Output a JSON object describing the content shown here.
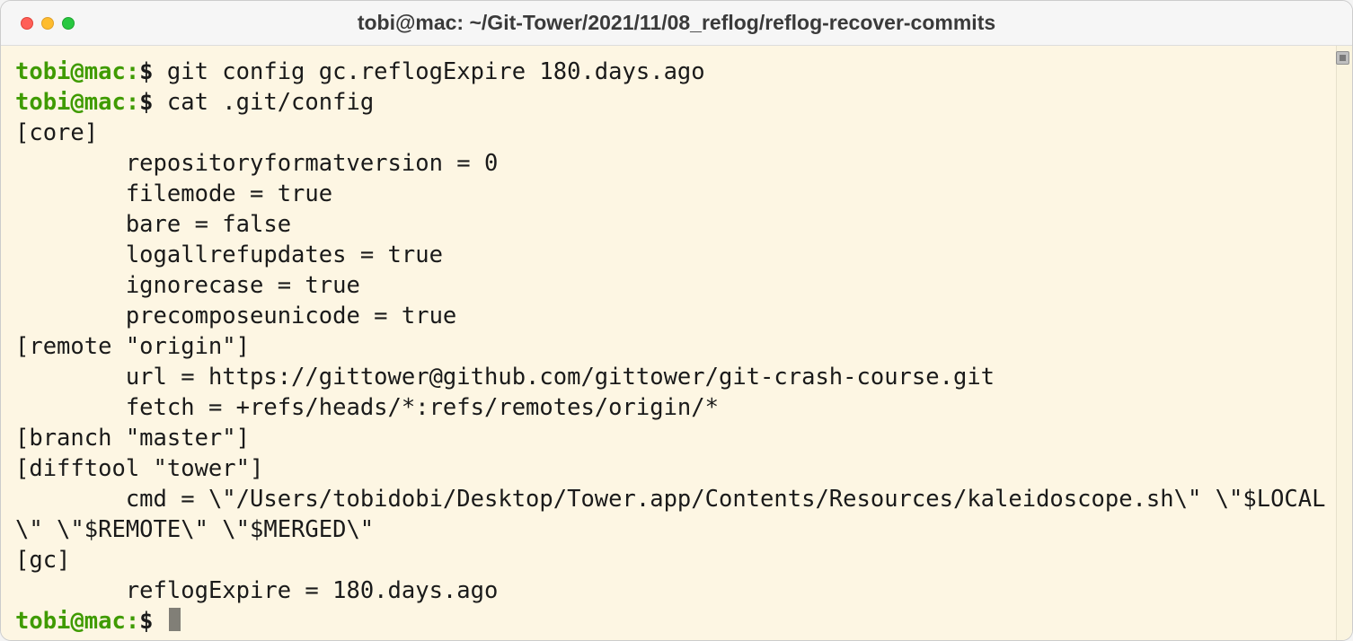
{
  "window": {
    "title": "tobi@mac: ~/Git-Tower/2021/11/08_reflog/reflog-recover-commits"
  },
  "prompt": "tobi@mac:",
  "dollar": "$",
  "lines": {
    "cmd1": "git config gc.reflogExpire 180.days.ago",
    "cmd2": "cat .git/config",
    "out0": "[core]",
    "out1": "        repositoryformatversion = 0",
    "out2": "        filemode = true",
    "out3": "        bare = false",
    "out4": "        logallrefupdates = true",
    "out5": "        ignorecase = true",
    "out6": "        precomposeunicode = true",
    "out7": "[remote \"origin\"]",
    "out8": "        url = https://gittower@github.com/gittower/git-crash-course.git",
    "out9": "        fetch = +refs/heads/*:refs/remotes/origin/*",
    "out10": "[branch \"master\"]",
    "out11": "[difftool \"tower\"]",
    "out12": "        cmd = \\\"/Users/tobidobi/Desktop/Tower.app/Contents/Resources/kaleidoscope.sh\\\" \\\"$LOCAL\\\" \\\"$REMOTE\\\" \\\"$MERGED\\\"",
    "out13": "[gc]",
    "out14": "        reflogExpire = 180.days.ago"
  }
}
